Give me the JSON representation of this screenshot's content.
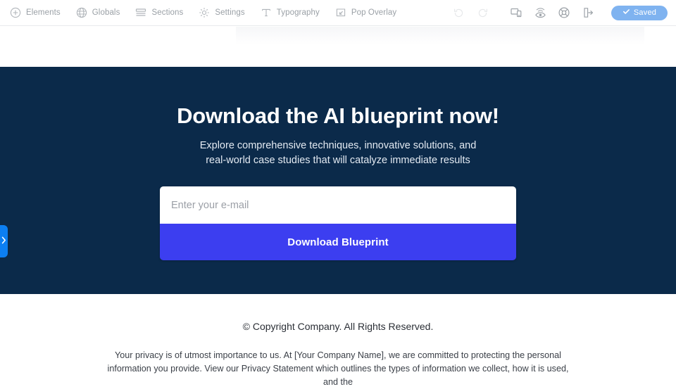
{
  "toolbar": {
    "left_items": [
      {
        "icon": "plus-circle-icon",
        "label": "Elements"
      },
      {
        "icon": "globe-icon",
        "label": "Globals"
      },
      {
        "icon": "sections-icon",
        "label": "Sections"
      },
      {
        "icon": "gear-icon",
        "label": "Settings"
      },
      {
        "icon": "typography-icon",
        "label": "Typography"
      },
      {
        "icon": "pop-overlay-icon",
        "label": "Pop Overlay"
      }
    ],
    "right_icons": [
      {
        "icon": "undo-icon",
        "state": "disabled"
      },
      {
        "icon": "redo-icon",
        "state": "disabled"
      },
      {
        "icon": "responsive-icon",
        "state": "enabled"
      },
      {
        "icon": "preview-eye-icon",
        "state": "enabled"
      },
      {
        "icon": "help-icon",
        "state": "enabled"
      },
      {
        "icon": "exit-icon",
        "state": "enabled"
      }
    ],
    "saved_label": "Saved",
    "saved_icon": "check-icon",
    "saved_color": "#7fb3f0"
  },
  "hero": {
    "title": "Download the AI blueprint now!",
    "subtitle": "Explore comprehensive techniques, innovative solutions, and real-world case studies that will catalyze immediate results",
    "background_color": "#0b2a4a",
    "form": {
      "email_placeholder": "Enter your e-mail",
      "email_value": "",
      "submit_label": "Download Blueprint",
      "submit_color": "#3c3ef0"
    }
  },
  "edge_tab": {
    "icon": "chevron-right-icon",
    "color": "#0c7ff2"
  },
  "footer": {
    "copyright": "© Copyright Company. All Rights Reserved.",
    "privacy_text": "Your privacy is of utmost importance to us. At [Your Company Name], we are committed to protecting the personal information you provide. View our Privacy Statement which outlines the types of information we collect, how it is used, and the"
  }
}
